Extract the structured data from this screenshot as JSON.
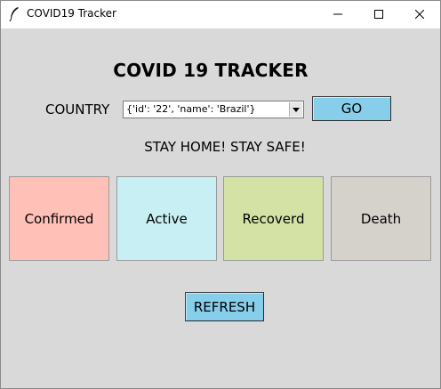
{
  "window": {
    "title": "COVID19 Tracker",
    "controls": {
      "minimize_icon": "minimize-icon",
      "maximize_icon": "maximize-icon",
      "close_icon": "close-icon"
    }
  },
  "header": {
    "title": "COVID 19 TRACKER"
  },
  "country": {
    "label": "COUNTRY",
    "selected_value": "{'id': '22', 'name': 'Brazil'}",
    "go_label": "GO"
  },
  "tagline": "STAY HOME! STAY SAFE!",
  "stats": [
    {
      "label": "Confirmed",
      "color": "#ffc0b8"
    },
    {
      "label": "Active",
      "color": "#c8eff3"
    },
    {
      "label": "Recoverd",
      "color": "#d4e2a6"
    },
    {
      "label": "Death",
      "color": "#d5d2cc"
    }
  ],
  "refresh_label": "REFRESH",
  "colors": {
    "background": "#d9d9d9",
    "button": "#87ceeb"
  }
}
